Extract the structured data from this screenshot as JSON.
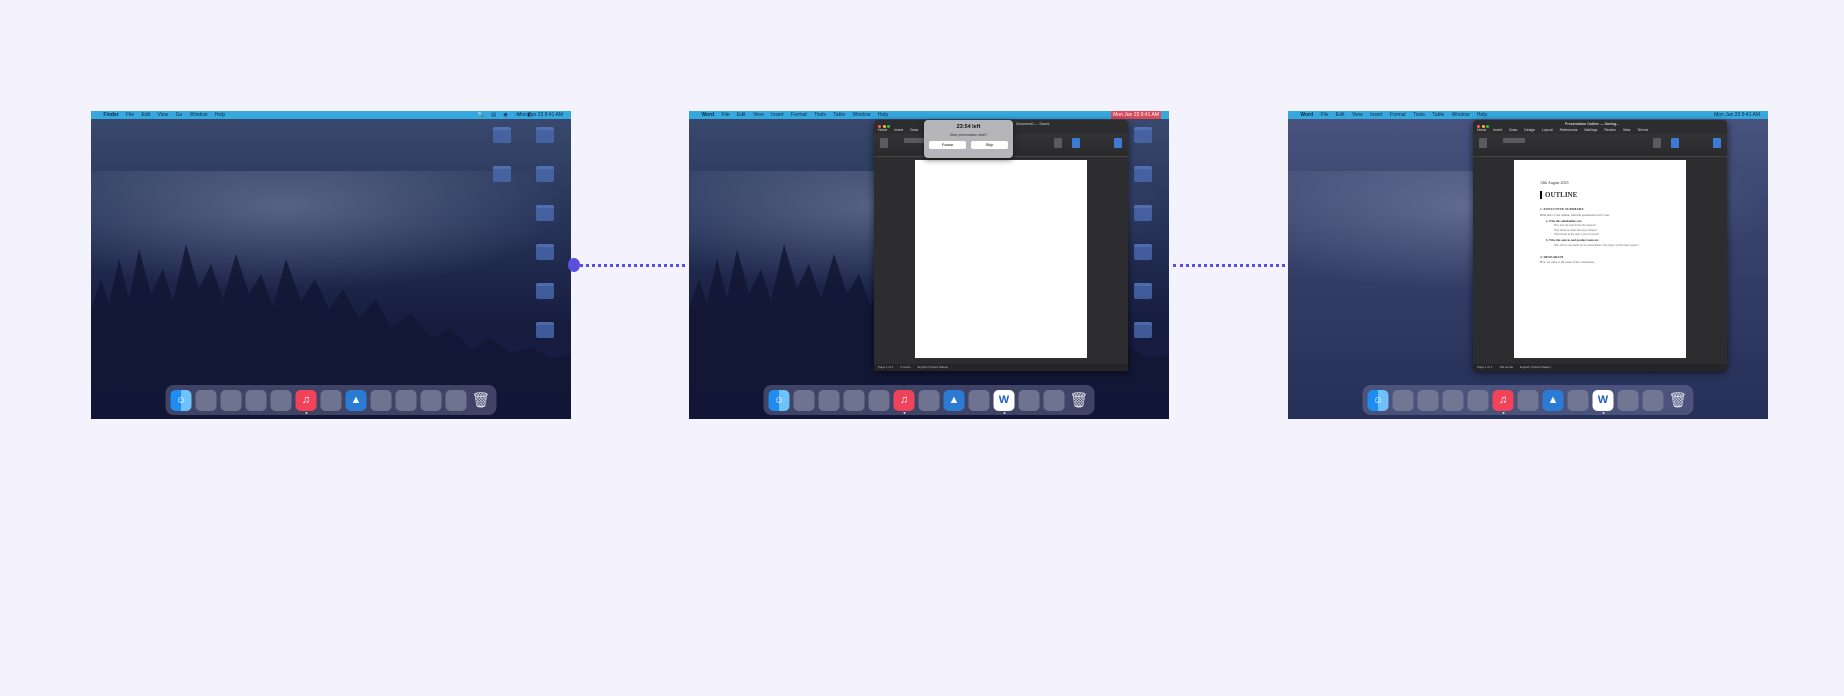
{
  "screen1": {
    "menubar": {
      "app": "Finder",
      "items": [
        "File",
        "Edit",
        "View",
        "Go",
        "Window",
        "Help"
      ],
      "clock": "Mon Jun 23  9:41 AM"
    },
    "desktop_icons": [
      "",
      "",
      "",
      "",
      "",
      "",
      "",
      "",
      "",
      ""
    ]
  },
  "screen2": {
    "menubar": {
      "app": "Word",
      "items": [
        "File",
        "Edit",
        "View",
        "Insert",
        "Format",
        "Tools",
        "Table",
        "Window",
        "Help"
      ],
      "clock": "Mon Jun 23  9:41 AM"
    },
    "window_title": "Document1 — Saved",
    "ribbon_tabs": [
      "Home",
      "Insert",
      "Draw"
    ],
    "dialog": {
      "title": "23:54 left",
      "subtitle": "Start presentation draft?",
      "pause_label": "Pause",
      "skip_label": "Skip"
    },
    "statusbar": [
      "Page 1 of 1",
      "0 words",
      "English (United States)"
    ]
  },
  "screen3": {
    "menubar": {
      "app": "Word",
      "items": [
        "File",
        "Edit",
        "View",
        "Insert",
        "Format",
        "Tools",
        "Table",
        "Window",
        "Help"
      ],
      "clock": "Mon Jun 23  9:41 AM"
    },
    "window_title": "Presentation Outline — Saving...",
    "ribbon_tabs": [
      "Home",
      "Insert",
      "Draw",
      "Design",
      "Layout",
      "References",
      "Mailings",
      "Review",
      "View",
      "Tell me"
    ],
    "document": {
      "date": "14th August 2023",
      "heading": "OUTLINE",
      "section1": "1.  EXECUTIVE SUMMARY",
      "section1_text": "Brief intro to the outline; what the presentation will cover.",
      "sub1": "a.  Who the stakeholders are",
      "list1": [
        "How does the team fit into the business?",
        "Why should we make these key changes?",
        "What should be the steps to move forward?"
      ],
      "sub2": "b.  Who the sources and product team are",
      "list2": [
        "Who will be responsible for the development of the project and the final product?"
      ],
      "section2": "2.  RESEARCH",
      "section2_text": "How we came to the areas of the conclusions"
    },
    "statusbar": [
      "Page 1 of 1",
      "102 words",
      "English (United States)"
    ]
  },
  "colors": {
    "menubar": "#36a8de",
    "connector": "#5b4fe0",
    "background": "#f4f3fd"
  }
}
